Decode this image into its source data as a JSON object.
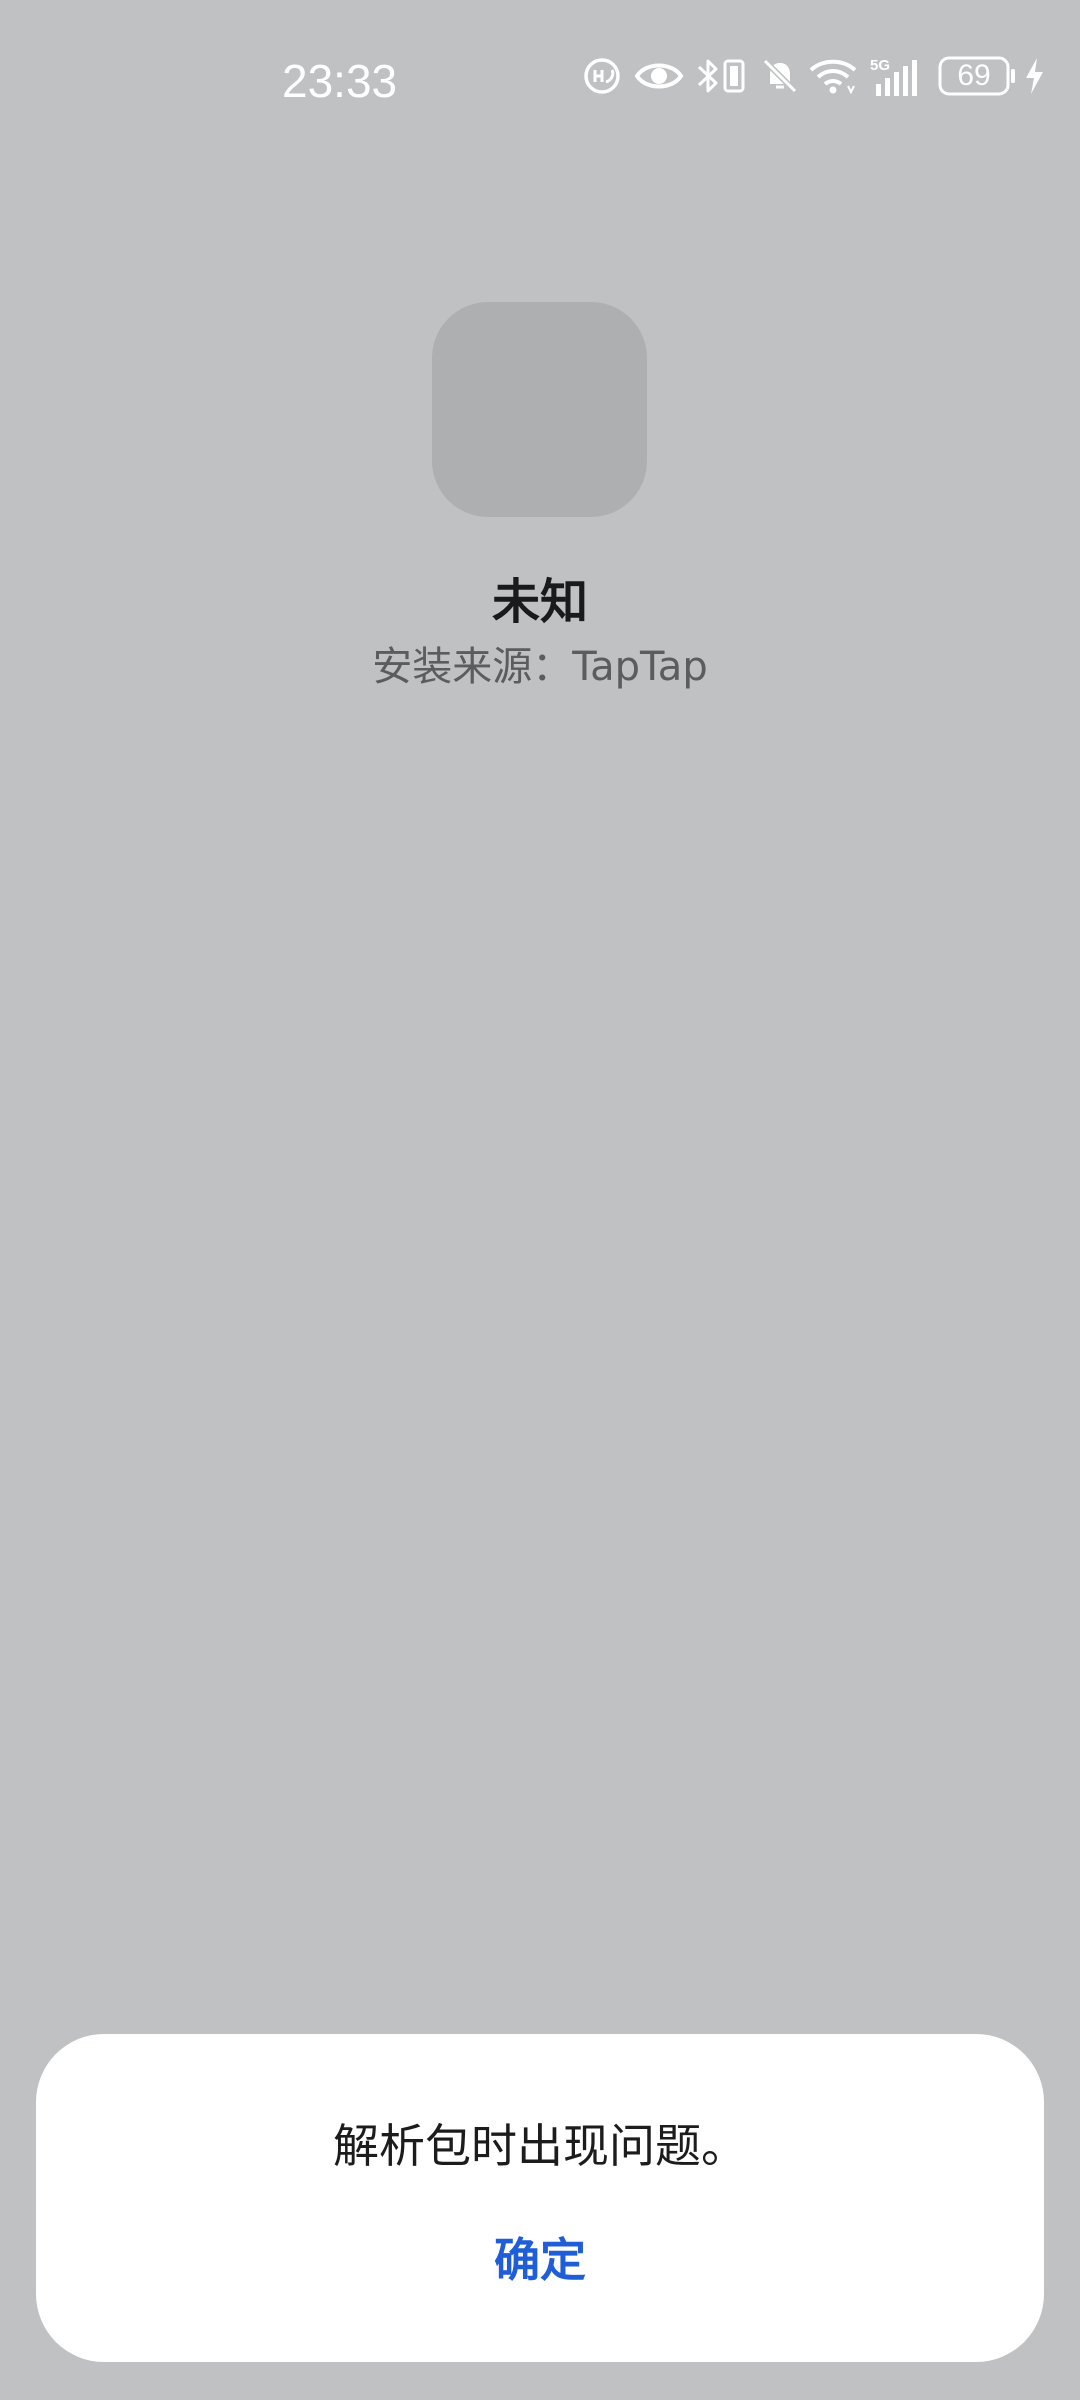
{
  "status_bar": {
    "time": "23:33",
    "battery_level": "69",
    "network_label": "5G",
    "icons": [
      "hd-call-icon",
      "eye-icon",
      "bluetooth-icon",
      "vibrate-icon",
      "bell-off-icon",
      "wifi-icon",
      "signal-icon",
      "battery-icon",
      "charging-icon"
    ]
  },
  "app": {
    "name": "未知",
    "install_source_label": "安装来源：",
    "install_source_value": "TapTap",
    "icon_placeholder_color": "#aeafb1"
  },
  "dialog": {
    "message": "解析包时出现问题。",
    "confirm_label": "确定",
    "accent_color": "#1f5ed6"
  },
  "colors": {
    "background": "#c0c1c3",
    "dialog_background": "#ffffff"
  }
}
